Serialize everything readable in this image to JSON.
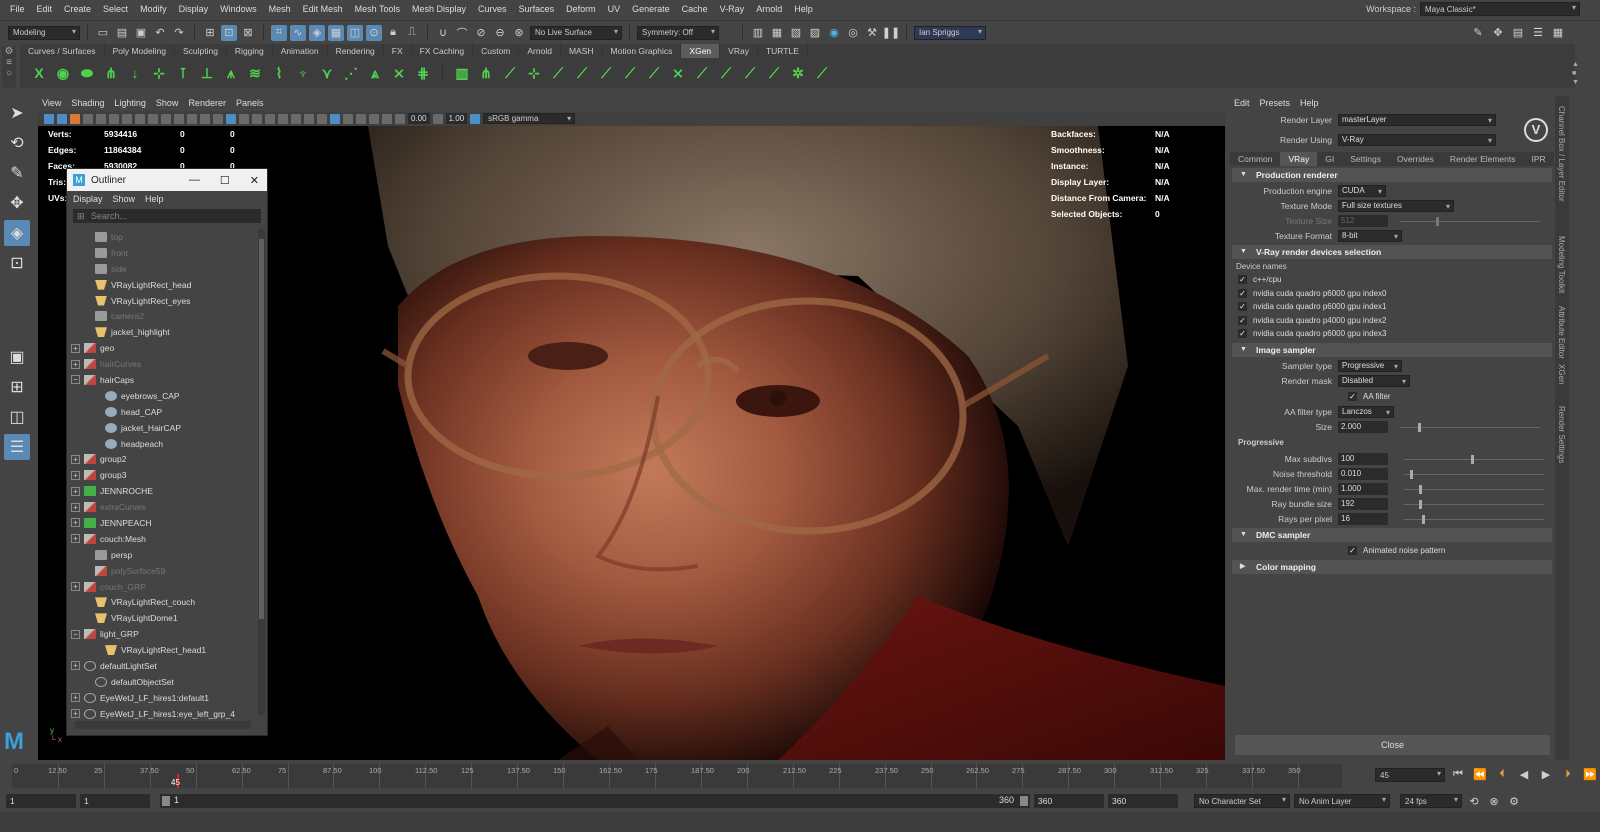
{
  "menubar": [
    "File",
    "Edit",
    "Create",
    "Select",
    "Modify",
    "Display",
    "Windows",
    "Mesh",
    "Edit Mesh",
    "Mesh Tools",
    "Mesh Display",
    "Curves",
    "Surfaces",
    "Deform",
    "UV",
    "Generate",
    "Cache",
    "V-Ray",
    "Arnold",
    "Help"
  ],
  "workspace": {
    "label": "Workspace :",
    "value": "Maya Classic*"
  },
  "statusline": {
    "mode": "Modeling",
    "live_surface": "No Live Surface",
    "symmetry": "Symmetry: Off",
    "user": "Ian Spriggs"
  },
  "shelf_tabs": [
    "Curves / Surfaces",
    "Poly Modeling",
    "Sculpting",
    "Rigging",
    "Animation",
    "Rendering",
    "FX",
    "FX Caching",
    "Custom",
    "Arnold",
    "MASH",
    "Motion Graphics",
    "XGen",
    "VRay",
    "TURTLE"
  ],
  "shelf_active": "XGen",
  "viewport_menu": [
    "View",
    "Shading",
    "Lighting",
    "Show",
    "Renderer",
    "Panels"
  ],
  "viewport_tool": {
    "exposure": "0.00",
    "gamma": "1.00",
    "colorspace": "sRGB gamma"
  },
  "hud_left": [
    {
      "label": "Verts:",
      "v1": "5934416",
      "v2": "0",
      "v3": "0"
    },
    {
      "label": "Edges:",
      "v1": "11864384",
      "v2": "0",
      "v3": "0"
    },
    {
      "label": "Faces:",
      "v1": "5930082",
      "v2": "0",
      "v3": "0"
    },
    {
      "label": "Tris:",
      "v1": "",
      "v2": "",
      "v3": ""
    },
    {
      "label": "UVs:",
      "v1": "",
      "v2": "",
      "v3": ""
    }
  ],
  "hud_right": [
    {
      "label": "Backfaces:",
      "value": "N/A"
    },
    {
      "label": "Smoothness:",
      "value": "N/A"
    },
    {
      "label": "Instance:",
      "value": "N/A"
    },
    {
      "label": "Display Layer:",
      "value": "N/A"
    },
    {
      "label": "Distance From Camera:",
      "value": "N/A"
    },
    {
      "label": "Selected Objects:",
      "value": "0"
    }
  ],
  "outliner": {
    "title": "Outliner",
    "menu": [
      "Display",
      "Show",
      "Help"
    ],
    "search_placeholder": "Search...",
    "items": [
      {
        "name": "top",
        "icon": "cam",
        "indent": 1,
        "dim": true,
        "exp": ""
      },
      {
        "name": "front",
        "icon": "cam",
        "indent": 1,
        "dim": true,
        "exp": ""
      },
      {
        "name": "side",
        "icon": "cam",
        "indent": 1,
        "dim": true,
        "exp": ""
      },
      {
        "name": "VRayLightRect_head",
        "icon": "lig",
        "indent": 1,
        "dim": false,
        "exp": ""
      },
      {
        "name": "VRayLightRect_eyes",
        "icon": "lig",
        "indent": 1,
        "dim": false,
        "exp": ""
      },
      {
        "name": "camera2",
        "icon": "cam",
        "indent": 1,
        "dim": true,
        "exp": ""
      },
      {
        "name": "jacket_highlight",
        "icon": "lig",
        "indent": 1,
        "dim": false,
        "exp": ""
      },
      {
        "name": "geo",
        "icon": "grp",
        "indent": 0,
        "dim": false,
        "exp": "+"
      },
      {
        "name": "hairCurves",
        "icon": "grp",
        "indent": 0,
        "dim": true,
        "exp": "+"
      },
      {
        "name": "hairCaps",
        "icon": "grp",
        "indent": 0,
        "dim": false,
        "exp": "−"
      },
      {
        "name": "eyebrows_CAP",
        "icon": "mesh",
        "indent": 2,
        "dim": false,
        "exp": ""
      },
      {
        "name": "head_CAP",
        "icon": "mesh",
        "indent": 2,
        "dim": false,
        "exp": ""
      },
      {
        "name": "jacket_HairCAP",
        "icon": "mesh",
        "indent": 2,
        "dim": false,
        "exp": ""
      },
      {
        "name": "headpeach",
        "icon": "mesh",
        "indent": 2,
        "dim": false,
        "exp": ""
      },
      {
        "name": "group2",
        "icon": "grp",
        "indent": 0,
        "dim": false,
        "exp": "+"
      },
      {
        "name": "group3",
        "icon": "grp",
        "indent": 0,
        "dim": false,
        "exp": "+"
      },
      {
        "name": "JENNROCHE",
        "icon": "xg",
        "indent": 0,
        "dim": false,
        "exp": "+"
      },
      {
        "name": "extraCurves",
        "icon": "grp",
        "indent": 0,
        "dim": true,
        "exp": "+"
      },
      {
        "name": "JENNPEACH",
        "icon": "xg",
        "indent": 0,
        "dim": false,
        "exp": "+"
      },
      {
        "name": "couch:Mesh",
        "icon": "grp",
        "indent": 0,
        "dim": false,
        "exp": "+"
      },
      {
        "name": "persp",
        "icon": "cam",
        "indent": 1,
        "dim": false,
        "exp": ""
      },
      {
        "name": "polySurface59",
        "icon": "grp",
        "indent": 1,
        "dim": true,
        "exp": ""
      },
      {
        "name": "couch_GRP",
        "icon": "grp",
        "indent": 0,
        "dim": true,
        "exp": "+"
      },
      {
        "name": "VRayLightRect_couch",
        "icon": "lig",
        "indent": 1,
        "dim": false,
        "exp": ""
      },
      {
        "name": "VRayLightDome1",
        "icon": "lig",
        "indent": 1,
        "dim": false,
        "exp": ""
      },
      {
        "name": "light_GRP",
        "icon": "grp",
        "indent": 0,
        "dim": false,
        "exp": "−"
      },
      {
        "name": "VRayLightRect_head1",
        "icon": "lig",
        "indent": 2,
        "dim": false,
        "exp": ""
      },
      {
        "name": "defaultLightSet",
        "icon": "set",
        "indent": 0,
        "dim": false,
        "exp": "+"
      },
      {
        "name": "defaultObjectSet",
        "icon": "set",
        "indent": 1,
        "dim": false,
        "exp": ""
      },
      {
        "name": "EyeWetJ_LF_hires1:default1",
        "icon": "set",
        "indent": 0,
        "dim": false,
        "exp": "+"
      },
      {
        "name": "EyeWetJ_LF_hires1:eye_left_grp_4",
        "icon": "set",
        "indent": 0,
        "dim": false,
        "exp": "+"
      }
    ]
  },
  "render": {
    "menu": [
      "Edit",
      "Presets",
      "Help"
    ],
    "render_layer_label": "Render Layer",
    "render_layer": "masterLayer",
    "render_using_label": "Render Using",
    "render_using": "V-Ray",
    "tabs": [
      "Common",
      "VRay",
      "GI",
      "Settings",
      "Overrides",
      "Render Elements",
      "IPR"
    ],
    "active_tab": "VRay",
    "production": {
      "title": "Production renderer",
      "engine_label": "Production engine",
      "engine": "CUDA",
      "texmode_label": "Texture Mode",
      "texmode": "Full size textures",
      "texsize_label": "Texture Size",
      "texsize": "512",
      "texformat_label": "Texture Format",
      "texformat": "8-bit"
    },
    "devices": {
      "title": "V-Ray render devices selection",
      "header": "Device names",
      "list": [
        "c++/cpu",
        "nvidia cuda quadro p6000 gpu index0",
        "nvidia cuda quadro p6000 gpu index1",
        "nvidia cuda quadro p4000 gpu index2",
        "nvidia cuda quadro p6000 gpu index3"
      ]
    },
    "sampler": {
      "title": "Image sampler",
      "type_label": "Sampler type",
      "type": "Progressive",
      "mask_label": "Render mask",
      "mask": "Disabled",
      "aa_label": "AA filter",
      "aatype_label": "AA filter type",
      "aatype": "Lanczos",
      "size_label": "Size",
      "size": "2.000"
    },
    "progressive": {
      "title": "Progressive",
      "fields": [
        {
          "label": "Max subdivs",
          "value": "100",
          "level": 0.48
        },
        {
          "label": "Noise threshold",
          "value": "0.010",
          "level": 0.04
        },
        {
          "label": "Max. render time (min)",
          "value": "1.000",
          "level": 0.11
        },
        {
          "label": "Ray bundle size",
          "value": "192",
          "level": 0.11
        },
        {
          "label": "Rays per pixel",
          "value": "16",
          "level": 0.13
        }
      ]
    },
    "dmc": {
      "title": "DMC sampler",
      "animated_label": "Animated noise pattern"
    },
    "color_mapping": "Color mapping",
    "close": "Close"
  },
  "side_tabs": [
    "Channel Box / Layer Editor",
    "Modeling Toolkit",
    "Attribute Editor",
    "XGen",
    "Render Settings"
  ],
  "timeline": {
    "ticks": [
      "12.50",
      "25",
      "37.50",
      "50",
      "62.50",
      "75",
      "87.50",
      "100",
      "112.50",
      "125",
      "137.50",
      "150",
      "162.50",
      "175",
      "187.50",
      "200",
      "212.50",
      "225",
      "237.50",
      "250",
      "262.50",
      "275",
      "287.50",
      "300",
      "312.50",
      "325",
      "337.50",
      "350"
    ],
    "start_label": "0",
    "current_frame": "45",
    "current": 45,
    "max": 362
  },
  "range": {
    "start": "1",
    "start2": "1",
    "slider_start": "1",
    "slider_end": "360",
    "end": "360",
    "end2": "360",
    "char_set": "No Character Set",
    "anim_layer": "No Anim Layer",
    "fps": "24 fps"
  },
  "colors": {
    "accent": "#5a8ab3",
    "xgen_green": "#4ed34e",
    "maya_blue": "#39a0d8"
  }
}
